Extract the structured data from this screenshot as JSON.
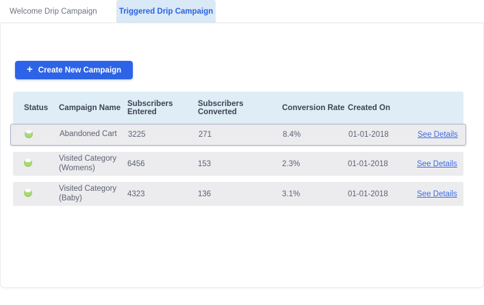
{
  "tabs": [
    {
      "label": "Welcome Drip Campaign",
      "active": false
    },
    {
      "label": "Triggered Drip Campaign",
      "active": true
    }
  ],
  "toolbar": {
    "plus_icon": "+",
    "create_button_label": "Create New Campaign"
  },
  "table": {
    "headers": [
      "Status",
      "Campaign Name",
      "Subscribers Entered",
      "Subscribers Converted",
      "Conversion Rate",
      "Created On"
    ],
    "rows": [
      {
        "status": "active",
        "campaign_name": "Abandoned Cart",
        "subscribers_entered": "3225",
        "subscribers_converted": "271",
        "conversion_rate": "8.4%",
        "created_on": "01-01-2018",
        "action": "See Details",
        "selected": true
      },
      {
        "status": "active",
        "campaign_name": "Visited Category (Womens)",
        "subscribers_entered": "6456",
        "subscribers_converted": "153",
        "conversion_rate": "2.3%",
        "created_on": "01-01-2018",
        "action": "See Details",
        "selected": false
      },
      {
        "status": "active",
        "campaign_name": "Visited Category (Baby)",
        "subscribers_entered": "4323",
        "subscribers_converted": "136",
        "conversion_rate": "3.1%",
        "created_on": "01-01-2018",
        "action": "See Details",
        "selected": false
      }
    ]
  },
  "colors": {
    "accent_blue": "#2d63e6",
    "active_tab_bg": "#d9e9f7",
    "active_tab_text": "#2c63e2",
    "header_bg": "#dfeef6",
    "row_bg": "#ececef",
    "selected_row_border": "#aab0cc",
    "status_green": "#a5d571",
    "link_blue": "#3c6ce1"
  }
}
